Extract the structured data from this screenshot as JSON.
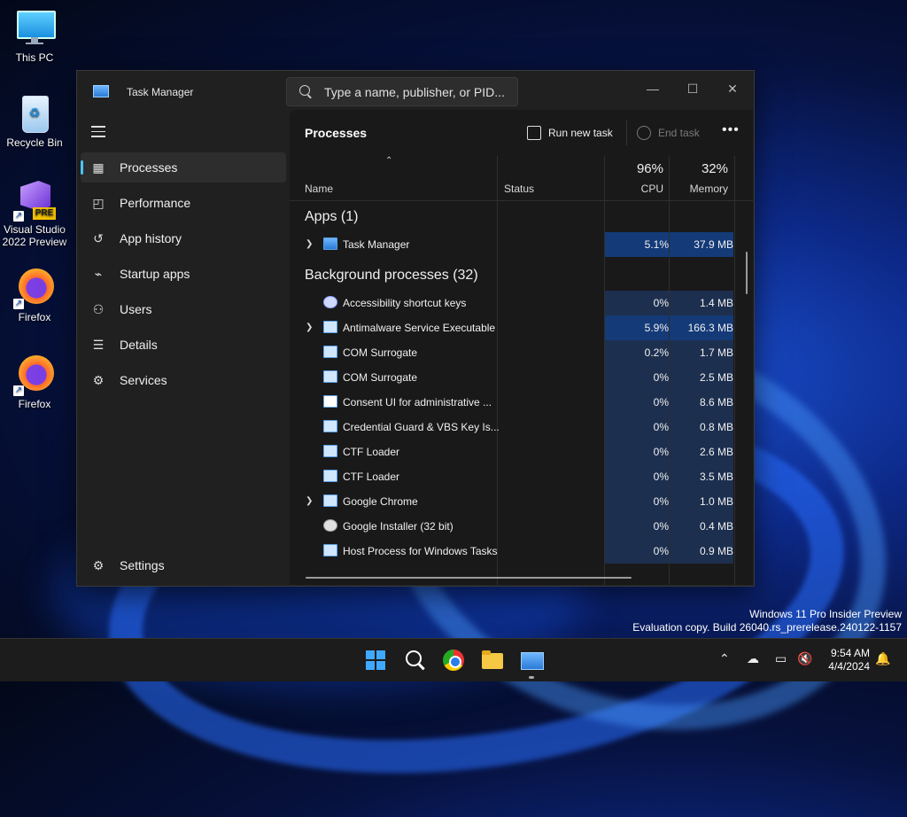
{
  "desktop": {
    "icons": [
      {
        "label": "This PC"
      },
      {
        "label": "Recycle Bin"
      },
      {
        "label": "Visual Studio 2022 Preview",
        "badge": "PRE"
      },
      {
        "label": "Firefox"
      },
      {
        "label": "Firefox"
      }
    ],
    "watermark": {
      "line1": "Windows 11 Pro Insider Preview",
      "line2": "Evaluation copy. Build 26040.rs_prerelease.240122-1157"
    }
  },
  "window": {
    "title": "Task Manager",
    "search_placeholder": "Type a name, publisher, or PID...",
    "controls": {
      "minimize": "—",
      "maximize": "☐",
      "close": "✕"
    }
  },
  "sidebar": {
    "items": [
      {
        "label": "Processes",
        "icon": "processes-icon",
        "active": true
      },
      {
        "label": "Performance",
        "icon": "performance-icon"
      },
      {
        "label": "App history",
        "icon": "app-history-icon"
      },
      {
        "label": "Startup apps",
        "icon": "startup-apps-icon"
      },
      {
        "label": "Users",
        "icon": "users-icon"
      },
      {
        "label": "Details",
        "icon": "details-icon"
      },
      {
        "label": "Services",
        "icon": "services-icon"
      }
    ],
    "settings_label": "Settings"
  },
  "commandbar": {
    "title": "Processes",
    "run_new_task": "Run new task",
    "end_task": "End task",
    "more": "•••"
  },
  "table": {
    "columns": {
      "name": "Name",
      "status": "Status",
      "cpu": "CPU",
      "memory": "Memory"
    },
    "cpu_total": "96%",
    "memory_total": "32%",
    "apps_group": "Apps (1)",
    "background_group": "Background processes (32)",
    "apps": [
      {
        "name": "Task Manager",
        "cpu": "5.1%",
        "mem": "37.9 MB",
        "expandable": true
      }
    ],
    "background": [
      {
        "name": "Accessibility shortcut keys",
        "cpu": "0%",
        "mem": "1.4 MB"
      },
      {
        "name": "Antimalware Service Executable",
        "cpu": "5.9%",
        "mem": "166.3 MB",
        "expandable": true
      },
      {
        "name": "COM Surrogate",
        "cpu": "0.2%",
        "mem": "1.7 MB"
      },
      {
        "name": "COM Surrogate",
        "cpu": "0%",
        "mem": "2.5 MB"
      },
      {
        "name": "Consent UI for administrative ...",
        "cpu": "0%",
        "mem": "8.6 MB"
      },
      {
        "name": "Credential Guard & VBS Key Is...",
        "cpu": "0%",
        "mem": "0.8 MB"
      },
      {
        "name": "CTF Loader",
        "cpu": "0%",
        "mem": "2.6 MB"
      },
      {
        "name": "CTF Loader",
        "cpu": "0%",
        "mem": "3.5 MB"
      },
      {
        "name": "Google Chrome",
        "cpu": "0%",
        "mem": "1.0 MB",
        "expandable": true
      },
      {
        "name": "Google Installer (32 bit)",
        "cpu": "0%",
        "mem": "0.4 MB"
      },
      {
        "name": "Host Process for Windows Tasks",
        "cpu": "0%",
        "mem": "0.9 MB"
      }
    ]
  },
  "taskbar": {
    "time": "9:54 AM",
    "date": "4/4/2024",
    "pinned": [
      "start-icon",
      "search-icon",
      "chrome-icon",
      "file-explorer-icon",
      "task-manager-icon"
    ]
  },
  "colors": {
    "accent": "#4cc2ff",
    "heat_high": "#143a78",
    "heat_low": "#1d2f4f"
  }
}
